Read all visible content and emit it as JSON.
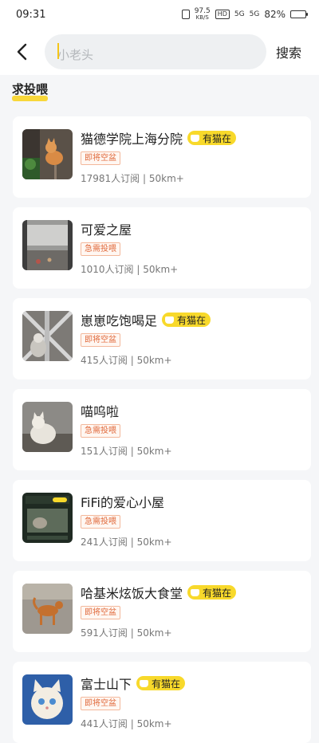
{
  "status": {
    "time": "09:31",
    "speed": "97.5",
    "speed_unit": "KB/S",
    "hd": "HD",
    "net1": "5G",
    "net2": "5G",
    "battery": "82%",
    "battery_level": 0.82
  },
  "header": {
    "back_icon": "chevron-left-icon",
    "search_placeholder": "小老头",
    "search_label": "搜索"
  },
  "section": {
    "title": "求投喂"
  },
  "cards": [
    {
      "name": "猫德学院上海分院",
      "badge": "有猫在",
      "tag": "即将空盆",
      "subscribers": "17981人订阅",
      "distance": "50km+"
    },
    {
      "name": "可爱之屋",
      "badge": "",
      "tag": "急需投喂",
      "subscribers": "1010人订阅",
      "distance": "50km+"
    },
    {
      "name": "崽崽吃饱喝足",
      "badge": "有猫在",
      "tag": "即将空盆",
      "subscribers": "415人订阅",
      "distance": "50km+"
    },
    {
      "name": "喵呜啦",
      "badge": "",
      "tag": "急需投喂",
      "subscribers": "151人订阅",
      "distance": "50km+"
    },
    {
      "name": "FiFi的爱心小屋",
      "badge": "",
      "tag": "急需投喂",
      "subscribers": "241人订阅",
      "distance": "50km+"
    },
    {
      "name": "哈基米炫饭大食堂",
      "badge": "有猫在",
      "tag": "即将空盆",
      "subscribers": "591人订阅",
      "distance": "50km+"
    },
    {
      "name": "富士山下",
      "badge": "有猫在",
      "tag": "即将空盆",
      "subscribers": "441人订阅",
      "distance": "50km+"
    }
  ],
  "meta_separator": " | "
}
